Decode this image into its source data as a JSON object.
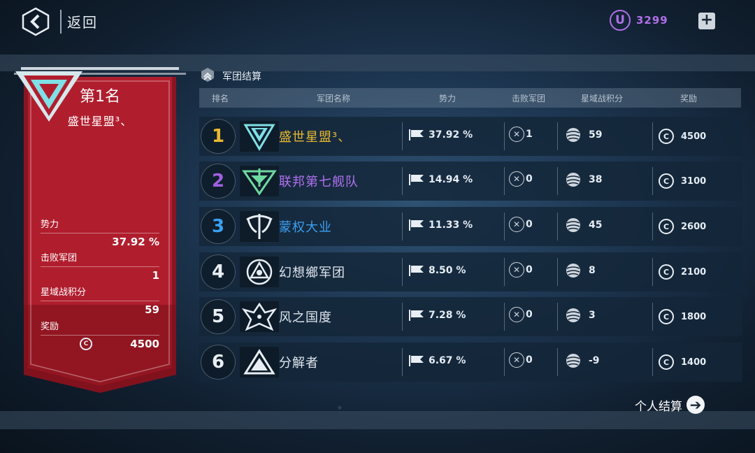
{
  "topbar": {
    "back_label": "返回",
    "currency_icon_letter": "U",
    "currency_value": "3299",
    "plus_label": "+"
  },
  "section": {
    "title": "军团结算"
  },
  "table": {
    "headers": [
      "排名",
      "军团名称",
      "势力",
      "击败军团",
      "星域战积分",
      "奖励"
    ],
    "rows": [
      {
        "rank": "1",
        "name": "盛世星盟³、",
        "power": "37.92 %",
        "defeated": "1",
        "score": "59",
        "reward": "4500",
        "rank_color": "#e8b830",
        "name_color": "#e8b830",
        "emblem_color": "#7fe0e6"
      },
      {
        "rank": "2",
        "name": "联邦第七舰队",
        "power": "14.94 %",
        "defeated": "0",
        "score": "38",
        "reward": "3100",
        "rank_color": "#a060e0",
        "name_color": "#b070f0",
        "emblem_color": "#6fd8a0"
      },
      {
        "rank": "3",
        "name": "蒙权大业",
        "power": "11.33 %",
        "defeated": "0",
        "score": "45",
        "reward": "2600",
        "rank_color": "#3aa0f0",
        "name_color": "#3aa0f0",
        "emblem_color": "#e8eef4"
      },
      {
        "rank": "4",
        "name": "幻想鄉军团",
        "power": "8.50 %",
        "defeated": "0",
        "score": "8",
        "reward": "2100",
        "rank_color": "#e8eef4",
        "name_color": "#dfe6ee",
        "emblem_color": "#e8eef4"
      },
      {
        "rank": "5",
        "name": "风之国度",
        "power": "7.28 %",
        "defeated": "0",
        "score": "3",
        "reward": "1800",
        "rank_color": "#e8eef4",
        "name_color": "#dfe6ee",
        "emblem_color": "#e8eef4"
      },
      {
        "rank": "6",
        "name": "分解者",
        "power": "6.67 %",
        "defeated": "0",
        "score": "-9",
        "reward": "1400",
        "rank_color": "#e8eef4",
        "name_color": "#dfe6ee",
        "emblem_color": "#e8eef4"
      }
    ]
  },
  "banner": {
    "rank_title": "第1名",
    "legion_name": "盛世星盟³、",
    "stats": {
      "power_label": "势力",
      "power_value": "37.92 %",
      "defeated_label": "击败军团",
      "defeated_value": "1",
      "score_label": "星域战积分",
      "score_value": "59",
      "reward_label": "奖励",
      "reward_value": "4500"
    },
    "color": "#b01e2e"
  },
  "coin_letter": "C",
  "personal_settlement_label": "个人结算",
  "personal_settlement_arrow": "➔",
  "icons": [
    "back-chevron-icon",
    "currency-u-icon",
    "plus-icon",
    "section-chevron-icon",
    "flag-icon",
    "skull-icon",
    "planet-icon",
    "coin-icon",
    "arrow-right-icon"
  ]
}
